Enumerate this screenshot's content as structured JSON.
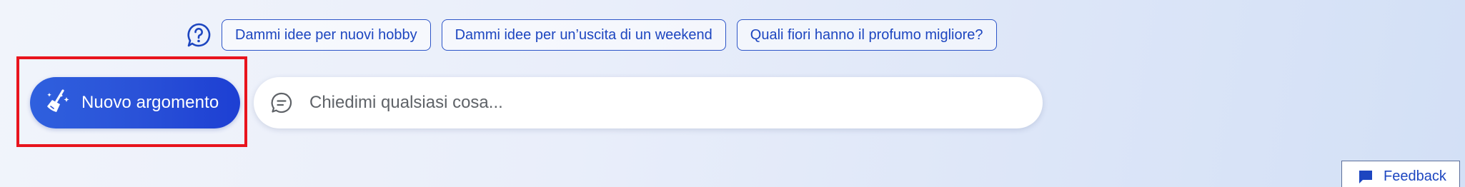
{
  "suggestions": {
    "help_icon": "question-circle-icon",
    "items": [
      "Dammi idee per nuovi hobby",
      "Dammi idee per un’uscita di un weekend",
      "Quali fiori hanno il profumo migliore?"
    ]
  },
  "new_topic": {
    "label": "Nuovo argomento",
    "icon": "broom-sparkle-icon"
  },
  "ask": {
    "placeholder": "Chiedimi qualsiasi cosa...",
    "value": "",
    "icon": "chat-bubble-icon"
  },
  "feedback": {
    "label": "Feedback",
    "icon": "feedback-icon"
  },
  "colors": {
    "accent": "#1d46c0",
    "button_gradient_start": "#2f60de",
    "button_gradient_end": "#1d3fd3",
    "highlight": "#e8141d"
  }
}
